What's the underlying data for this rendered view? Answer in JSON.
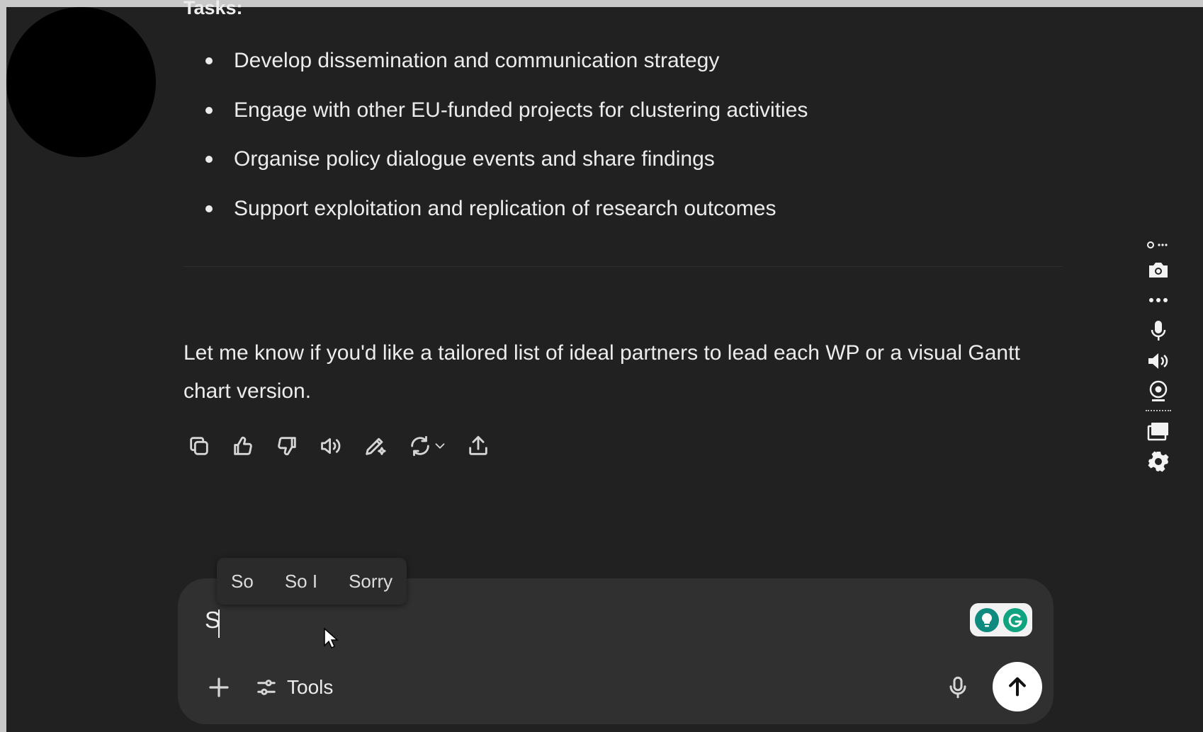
{
  "message": {
    "cutoff_heading": "Tasks:",
    "bullets": [
      "Develop dissemination and communication strategy",
      "Engage with other EU-funded projects for clustering activities",
      "Organise policy dialogue events and share findings",
      "Support exploitation and replication of research outcomes"
    ],
    "follow_up": "Let me know if you'd like a tailored list of ideal partners to lead each WP or a visual Gantt chart version."
  },
  "message_actions": [
    "copy-icon",
    "thumbs-up-icon",
    "thumbs-down-icon",
    "read-aloud-icon",
    "edit-icon",
    "regenerate-icon",
    "share-icon"
  ],
  "side_toolbar": [
    "link-more-icon",
    "camera-icon",
    "more-icon",
    "microphone-icon",
    "speaker-icon",
    "webcam-icon",
    "window-icon",
    "gear-icon"
  ],
  "composer": {
    "typed_text": "S",
    "tools_label": "Tools"
  },
  "autocomplete": {
    "suggestions": [
      "So",
      "So I",
      "Sorry"
    ]
  },
  "colors": {
    "background": "#212121",
    "composer": "#303030",
    "text": "#ececec",
    "send_button": "#ffffff",
    "grammarly": "#0fa37f"
  }
}
